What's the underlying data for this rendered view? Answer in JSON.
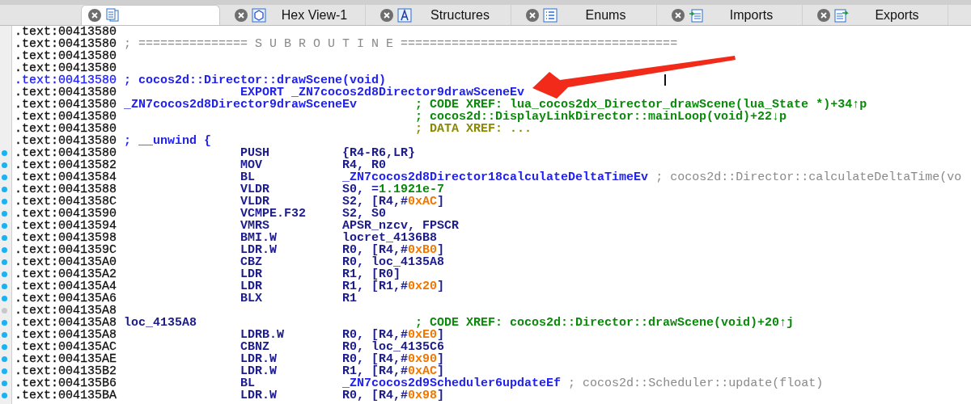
{
  "tabs": [
    {
      "selected": true
    },
    {
      "label": "Hex View-1",
      "selected": false
    },
    {
      "label": "Structures",
      "selected": false
    },
    {
      "label": "Enums",
      "selected": false
    },
    {
      "label": "Imports",
      "selected": false
    },
    {
      "label": "Exports",
      "selected": false
    }
  ],
  "listing": {
    "lines": [
      {
        "address": ".text:00413580"
      },
      {
        "address": ".text:00413580",
        "parts": [
          {
            "kind": "separator",
            "text": "; =============== S U B R O U T I N E ======================================"
          }
        ]
      },
      {
        "address": ".text:00413580"
      },
      {
        "address": ".text:00413580"
      },
      {
        "address": ".text:00413580",
        "highlighted": true,
        "parts": [
          {
            "kind": "header_comment",
            "text": "; cocos2d::Director::drawScene(void)"
          }
        ]
      },
      {
        "address": ".text:00413580",
        "parts": [
          {
            "kind": "directive",
            "text": "EXPORT _ZN7cocos2d8Director9drawSceneEv"
          }
        ]
      },
      {
        "address": ".text:00413580",
        "parts": [
          {
            "kind": "function_name",
            "text": "_ZN7cocos2d8Director9drawSceneEv"
          },
          {
            "kind": "code_xref",
            "text": "; CODE XREF: lua_cocos2dx_Director_drawScene(lua_State *)+34↑p"
          }
        ]
      },
      {
        "address": ".text:00413580",
        "parts": [
          {
            "kind": "code_xref",
            "text": "; cocos2d::DisplayLinkDirector::mainLoop(void)+22↓p"
          }
        ]
      },
      {
        "address": ".text:00413580",
        "parts": [
          {
            "kind": "data_xref",
            "text": "; DATA XREF: ..."
          }
        ]
      },
      {
        "address": ".text:00413580",
        "parts": [
          {
            "kind": "header_comment",
            "text": "; __unwind {"
          }
        ]
      },
      {
        "address": ".text:00413580",
        "color": "#1ab2f0",
        "parts": [
          {
            "kind": "mnemonic",
            "text": "PUSH"
          },
          {
            "kind": "operands",
            "tokens": [
              {
                "kind": "plain",
                "text": "{R4-R6,LR}"
              }
            ]
          }
        ]
      },
      {
        "address": ".text:00413582",
        "color": "#1ab2f0",
        "parts": [
          {
            "kind": "mnemonic",
            "text": "MOV"
          },
          {
            "kind": "operands",
            "tokens": [
              {
                "kind": "plain",
                "text": "R4, R0"
              }
            ]
          }
        ]
      },
      {
        "address": ".text:00413584",
        "color": "#1ab2f0",
        "parts": [
          {
            "kind": "mnemonic",
            "text": "BL"
          },
          {
            "kind": "operands",
            "tokens": [
              {
                "kind": "name",
                "text": "_ZN7cocos2d8Director18calculateDeltaTimeEv"
              }
            ]
          },
          {
            "kind": "auto_comment",
            "text": "; cocos2d::Director::calculateDeltaTime(vo"
          }
        ]
      },
      {
        "address": ".text:00413588",
        "color": "#1ab2f0",
        "parts": [
          {
            "kind": "mnemonic",
            "text": "VLDR"
          },
          {
            "kind": "operands",
            "tokens": [
              {
                "kind": "plain",
                "text": "S0, ="
              },
              {
                "kind": "float",
                "text": "1.1921e-7"
              }
            ]
          }
        ]
      },
      {
        "address": ".text:0041358C",
        "color": "#1ab2f0",
        "parts": [
          {
            "kind": "mnemonic",
            "text": "VLDR"
          },
          {
            "kind": "operands",
            "tokens": [
              {
                "kind": "plain",
                "text": "S2, [R4,#"
              },
              {
                "kind": "number",
                "text": "0xAC"
              },
              {
                "kind": "plain",
                "text": "]"
              }
            ]
          }
        ]
      },
      {
        "address": ".text:00413590",
        "color": "#1ab2f0",
        "parts": [
          {
            "kind": "mnemonic",
            "text": "VCMPE.F32"
          },
          {
            "kind": "operands",
            "tokens": [
              {
                "kind": "plain",
                "text": "S2, S0"
              }
            ]
          }
        ]
      },
      {
        "address": ".text:00413594",
        "color": "#1ab2f0",
        "parts": [
          {
            "kind": "mnemonic",
            "text": "VMRS"
          },
          {
            "kind": "operands",
            "tokens": [
              {
                "kind": "plain",
                "text": "APSR_nzcv, FPSCR"
              }
            ]
          }
        ]
      },
      {
        "address": ".text:00413598",
        "color": "#1ab2f0",
        "parts": [
          {
            "kind": "mnemonic",
            "text": "BMI.W"
          },
          {
            "kind": "operands",
            "tokens": [
              {
                "kind": "plain",
                "text": "locret_4136B8"
              }
            ]
          }
        ]
      },
      {
        "address": ".text:0041359C",
        "color": "#1ab2f0",
        "parts": [
          {
            "kind": "mnemonic",
            "text": "LDR.W"
          },
          {
            "kind": "operands",
            "tokens": [
              {
                "kind": "plain",
                "text": "R0, [R4,#"
              },
              {
                "kind": "number",
                "text": "0xB0"
              },
              {
                "kind": "plain",
                "text": "]"
              }
            ]
          }
        ]
      },
      {
        "address": ".text:004135A0",
        "color": "#1ab2f0",
        "parts": [
          {
            "kind": "mnemonic",
            "text": "CBZ"
          },
          {
            "kind": "operands",
            "tokens": [
              {
                "kind": "plain",
                "text": "R0, loc_4135A8"
              }
            ]
          }
        ]
      },
      {
        "address": ".text:004135A2",
        "color": "#1ab2f0",
        "parts": [
          {
            "kind": "mnemonic",
            "text": "LDR"
          },
          {
            "kind": "operands",
            "tokens": [
              {
                "kind": "plain",
                "text": "R1, [R0]"
              }
            ]
          }
        ]
      },
      {
        "address": ".text:004135A4",
        "color": "#1ab2f0",
        "parts": [
          {
            "kind": "mnemonic",
            "text": "LDR"
          },
          {
            "kind": "operands",
            "tokens": [
              {
                "kind": "plain",
                "text": "R1, [R1,#"
              },
              {
                "kind": "number",
                "text": "0x20"
              },
              {
                "kind": "plain",
                "text": "]"
              }
            ]
          }
        ]
      },
      {
        "address": ".text:004135A6",
        "color": "#1ab2f0",
        "parts": [
          {
            "kind": "mnemonic",
            "text": "BLX"
          },
          {
            "kind": "operands",
            "tokens": [
              {
                "kind": "plain",
                "text": "R1"
              }
            ]
          }
        ]
      },
      {
        "address": ".text:004135A8",
        "color": "#c8c8c8"
      },
      {
        "address": ".text:004135A8",
        "color": "#1ab2f0",
        "parts": [
          {
            "kind": "label",
            "text": "loc_4135A8"
          },
          {
            "kind": "code_xref",
            "text": "; CODE XREF: cocos2d::Director::drawScene(void)+20↑j"
          }
        ]
      },
      {
        "address": ".text:004135A8",
        "color": "#1ab2f0",
        "parts": [
          {
            "kind": "mnemonic",
            "text": "LDRB.W"
          },
          {
            "kind": "operands",
            "tokens": [
              {
                "kind": "plain",
                "text": "R0, [R4,#"
              },
              {
                "kind": "number",
                "text": "0xE0"
              },
              {
                "kind": "plain",
                "text": "]"
              }
            ]
          }
        ]
      },
      {
        "address": ".text:004135AC",
        "color": "#1ab2f0",
        "parts": [
          {
            "kind": "mnemonic",
            "text": "CBNZ"
          },
          {
            "kind": "operands",
            "tokens": [
              {
                "kind": "plain",
                "text": "R0, loc_4135C6"
              }
            ]
          }
        ]
      },
      {
        "address": ".text:004135AE",
        "color": "#1ab2f0",
        "parts": [
          {
            "kind": "mnemonic",
            "text": "LDR.W"
          },
          {
            "kind": "operands",
            "tokens": [
              {
                "kind": "plain",
                "text": "R0, [R4,#"
              },
              {
                "kind": "number",
                "text": "0x90"
              },
              {
                "kind": "plain",
                "text": "]"
              }
            ]
          }
        ]
      },
      {
        "address": ".text:004135B2",
        "color": "#1ab2f0",
        "parts": [
          {
            "kind": "mnemonic",
            "text": "LDR.W"
          },
          {
            "kind": "operands",
            "tokens": [
              {
                "kind": "plain",
                "text": "R1, [R4,#"
              },
              {
                "kind": "number",
                "text": "0xAC"
              },
              {
                "kind": "plain",
                "text": "]"
              }
            ]
          }
        ]
      },
      {
        "address": ".text:004135B6",
        "color": "#1ab2f0",
        "parts": [
          {
            "kind": "mnemonic",
            "text": "BL"
          },
          {
            "kind": "operands",
            "tokens": [
              {
                "kind": "name",
                "text": "_ZN7cocos2d9Scheduler6updateEf"
              }
            ]
          },
          {
            "kind": "auto_comment",
            "text": "; cocos2d::Scheduler::update(float)"
          }
        ]
      },
      {
        "address": ".text:004135BA",
        "color": "#1ab2f0",
        "parts": [
          {
            "kind": "mnemonic",
            "text": "LDR.W"
          },
          {
            "kind": "operands",
            "tokens": [
              {
                "kind": "plain",
                "text": "R0, [R4,#"
              },
              {
                "kind": "number",
                "text": "0x98"
              },
              {
                "kind": "plain",
                "text": "]"
              }
            ]
          }
        ]
      }
    ]
  },
  "annotation_arrow": true,
  "text_cursor": true
}
